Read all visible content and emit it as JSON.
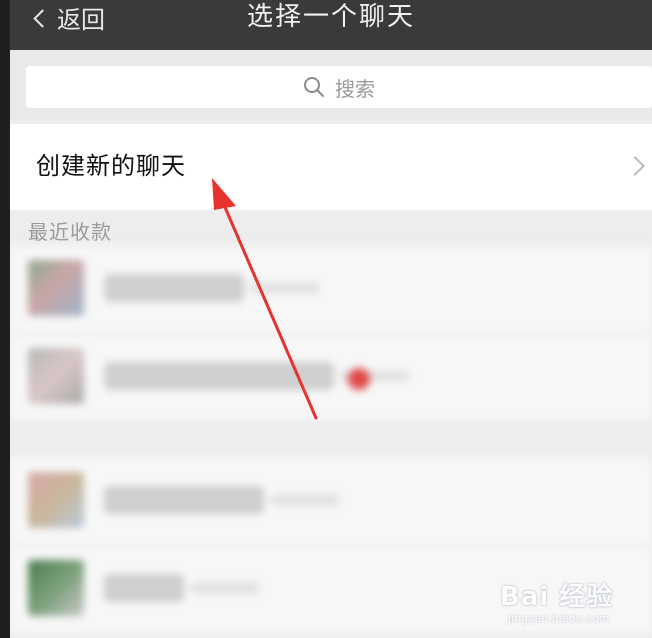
{
  "navbar": {
    "back_label": "返回",
    "title": "选择一个聊天",
    "background": "#3a3a3a"
  },
  "search": {
    "placeholder": "搜索",
    "icon": "search-icon"
  },
  "create_chat": {
    "label": "创建新的聊天",
    "icon": "chevron-right-icon"
  },
  "sections": {
    "recent": {
      "label": "最近收款"
    },
    "second": {
      "label": ""
    }
  },
  "annotation": {
    "type": "red-arrow",
    "color": "#e8322e",
    "points_to": "create-chat-row"
  },
  "watermark": {
    "logo": "Bai 经验",
    "url": "jingyan.baidu.com"
  },
  "colors": {
    "page_bg": "#ededed",
    "row_bg": "#ffffff",
    "accent_red": "#e04848"
  }
}
